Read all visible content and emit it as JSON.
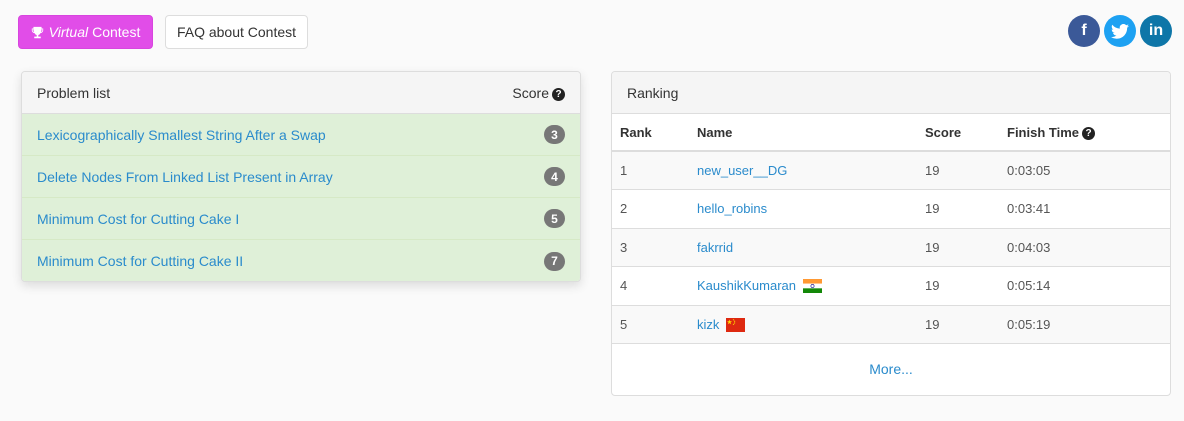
{
  "top_buttons": {
    "virtual_em": "Virtual",
    "virtual_label": "Contest",
    "faq_label": "FAQ about Contest"
  },
  "social": {
    "facebook": "f",
    "twitter": "twitter-icon",
    "linkedin": "in"
  },
  "problems": {
    "title": "Problem list",
    "score_label": "Score",
    "items": [
      {
        "name": "Lexicographically Smallest String After a Swap",
        "score": "3"
      },
      {
        "name": "Delete Nodes From Linked List Present in Array",
        "score": "4"
      },
      {
        "name": "Minimum Cost for Cutting Cake I",
        "score": "5"
      },
      {
        "name": "Minimum Cost for Cutting Cake II",
        "score": "7"
      }
    ]
  },
  "ranking": {
    "title": "Ranking",
    "columns": {
      "rank": "Rank",
      "name": "Name",
      "score": "Score",
      "finish": "Finish Time"
    },
    "rows": [
      {
        "rank": "1",
        "name": "new_user__DG",
        "score": "19",
        "finish": "0:03:05",
        "flag": ""
      },
      {
        "rank": "2",
        "name": "hello_robins",
        "score": "19",
        "finish": "0:03:41",
        "flag": ""
      },
      {
        "rank": "3",
        "name": "fakrrid",
        "score": "19",
        "finish": "0:04:03",
        "flag": ""
      },
      {
        "rank": "4",
        "name": "KaushikKumaran",
        "score": "19",
        "finish": "0:05:14",
        "flag": "india-flag-icon"
      },
      {
        "rank": "5",
        "name": "kizk",
        "score": "19",
        "finish": "0:05:19",
        "flag": "china-flag-icon"
      }
    ],
    "more": "More..."
  },
  "colors": {
    "accent_virtual": "#e14de8",
    "solved_row": "#dff0d8",
    "link": "#2a8bcc",
    "badge": "#777777"
  }
}
